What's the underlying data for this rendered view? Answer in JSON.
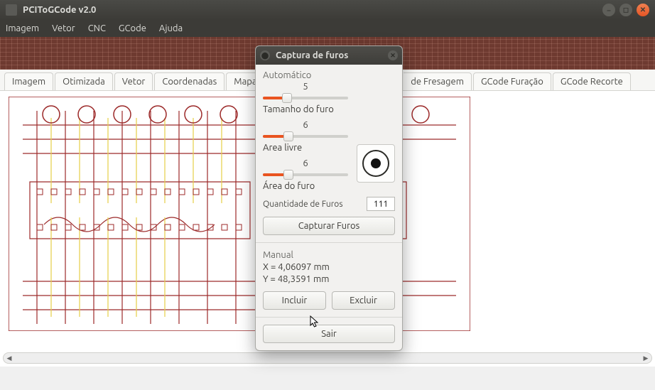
{
  "window": {
    "title": "PCIToGCode  v2.0"
  },
  "menu": {
    "items": [
      "Imagem",
      "Vetor",
      "CNC",
      "GCode",
      "Ajuda"
    ]
  },
  "tabs": {
    "left": [
      "Imagem",
      "Otimizada",
      "Vetor",
      "Coordenadas"
    ],
    "partial_left": "Mapa",
    "partial_right": "de Fresagem",
    "right": [
      "GCode Furação",
      "GCode Recorte"
    ]
  },
  "dialog": {
    "title": "Captura de furos",
    "auto_label": "Automático",
    "slider1": {
      "value": "5",
      "fill": 28,
      "label": "Tamanho do furo"
    },
    "slider2": {
      "value": "6",
      "fill": 30,
      "label": "Area livre"
    },
    "slider3": {
      "value": "6",
      "fill": 30,
      "label": "Área do furo"
    },
    "qty_label": "Quantidade de Furos",
    "qty_value": "111",
    "capture_btn": "Capturar Furos",
    "manual_label": "Manual",
    "x_line": "X = 4,06097 mm",
    "y_line": "Y = 48,3591 mm",
    "include_btn": "Incluir",
    "exclude_btn": "Excluir",
    "exit_btn": "Sair"
  }
}
